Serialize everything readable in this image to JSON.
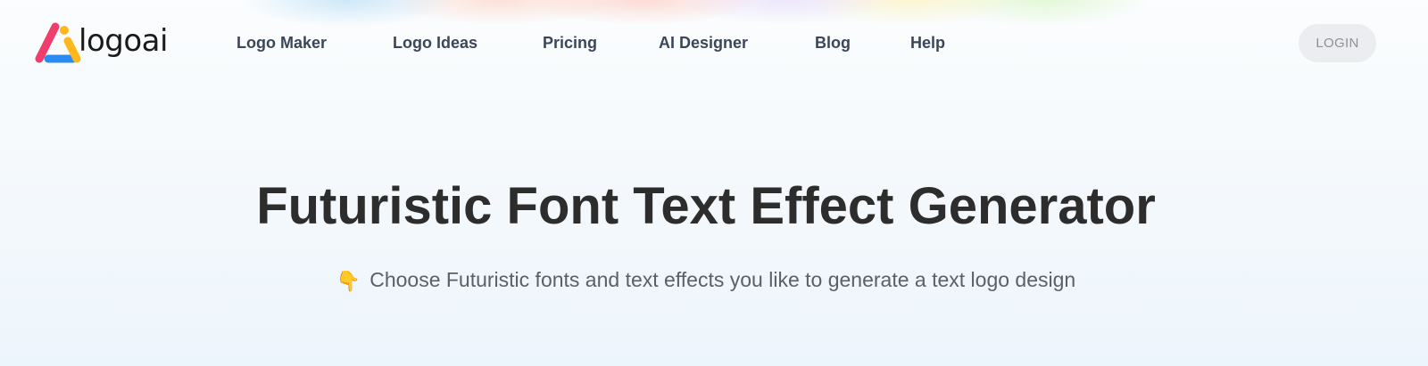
{
  "brand": {
    "name": "logoai",
    "mark_colors": {
      "pink": "#f23c6b",
      "yellow": "#ffb81c",
      "blue": "#2a8cf0"
    }
  },
  "nav": {
    "items": [
      {
        "label": "Logo Maker"
      },
      {
        "label": "Logo Ideas"
      },
      {
        "label": "Pricing"
      },
      {
        "label": "AI Designer"
      },
      {
        "label": "Blog"
      },
      {
        "label": "Help"
      }
    ]
  },
  "header": {
    "login_label": "LOGIN"
  },
  "hero": {
    "title": "Futuristic Font Text Effect Generator",
    "subtitle_icon": "pointing-down-hand-icon",
    "subtitle_emoji": "👇",
    "subtitle": "Choose Futuristic fonts and text effects you like to generate a text logo design"
  }
}
